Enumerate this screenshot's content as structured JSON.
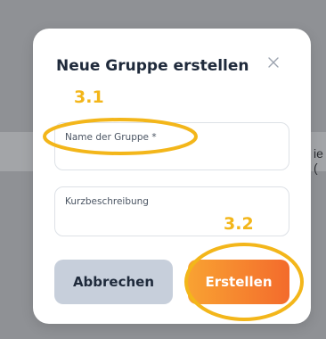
{
  "backdrop": {
    "partial_text": "ie ("
  },
  "dialog": {
    "title": "Neue Gruppe erstellen",
    "close_icon": "close-icon",
    "fields": {
      "name_label": "Name der Gruppe *",
      "name_value": "",
      "description_label": "Kurzbeschreibung",
      "description_value": ""
    },
    "buttons": {
      "cancel_label": "Abbrechen",
      "create_label": "Erstellen"
    }
  },
  "annotations": {
    "step1": "3.1",
    "step2": "3.2",
    "color": "#f3b61a"
  },
  "colors": {
    "overlay": "#8f9195",
    "title": "#1f2a3b",
    "cancel_bg": "#c7cfdb",
    "create_gradient_start": "#f9a232",
    "create_gradient_end": "#f36b2c"
  }
}
